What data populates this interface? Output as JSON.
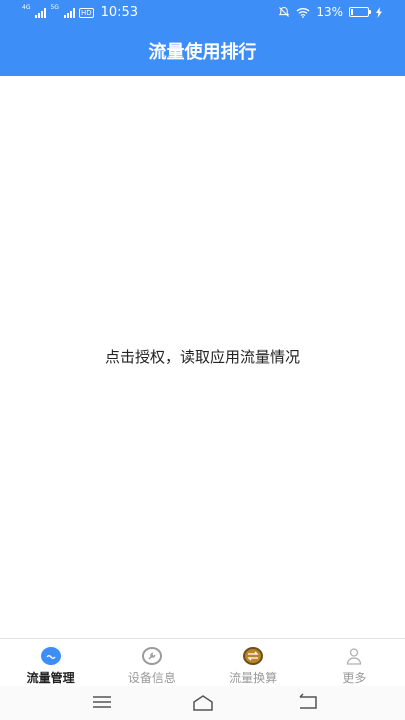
{
  "status": {
    "network_1": "4G",
    "network_2": "5G",
    "hd": "HD",
    "time": "10:53",
    "battery": "13%",
    "battery_level": 0.13
  },
  "header": {
    "title": "流量使用排行"
  },
  "main": {
    "message": "点击授权，读取应用流量情况"
  },
  "tabs": [
    {
      "label": "流量管理",
      "icon": "water-drop-icon",
      "active": true,
      "color": "#3e8ef7"
    },
    {
      "label": "设备信息",
      "icon": "wrench-icon",
      "active": false,
      "color": "#9a9a9a"
    },
    {
      "label": "流量换算",
      "icon": "swap-icon",
      "active": false,
      "color": "#b8862b"
    },
    {
      "label": "更多",
      "icon": "person-icon",
      "active": false,
      "color": "#b0b0b0"
    }
  ],
  "colors": {
    "primary": "#3e8ef7"
  }
}
